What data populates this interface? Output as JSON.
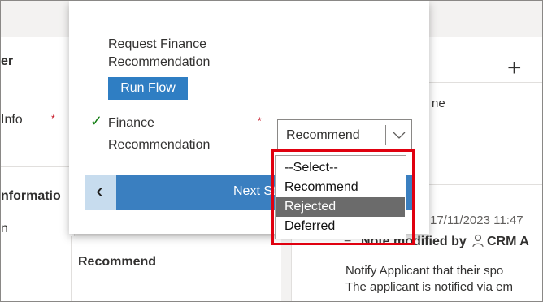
{
  "background": {
    "left_header_fragment": "er",
    "left_info_fragment": "Info",
    "left_info_required_marker": "*",
    "left_section_fragment": "nformatio",
    "left_bottom_fragment": "n",
    "field_value": "Recommend",
    "right_add_icon": "+",
    "right_name_fragment": "ne",
    "timeline_date": "17/11/2023 11:47",
    "note_icon": "≡",
    "note_title_prefix": "Note modified by",
    "user_icon": "person-icon",
    "note_author": "CRM A",
    "note_line1": "Notify Applicant that their spo",
    "note_line2": "The applicant is notified via em"
  },
  "flyout": {
    "request_label_line1": "Request Finance",
    "request_label_line2": "Recommendation",
    "run_flow_label": "Run Flow",
    "field_label_line1": "Finance",
    "field_label_line2": "Recommendation",
    "check_icon": "✓",
    "required_marker": "*",
    "select_value": "Recommend",
    "prev_icon": "‹",
    "next_stage_label": "Next Stage"
  },
  "dropdown": {
    "options": [
      "--Select--",
      "Recommend",
      "Rejected",
      "Deferred"
    ],
    "highlighted_option": "Rejected"
  },
  "colors": {
    "accent": "#2f7ec3",
    "highlight": "#e0000f",
    "selected_option_bg": "#6b6b6b",
    "required": "#c50f1f"
  }
}
